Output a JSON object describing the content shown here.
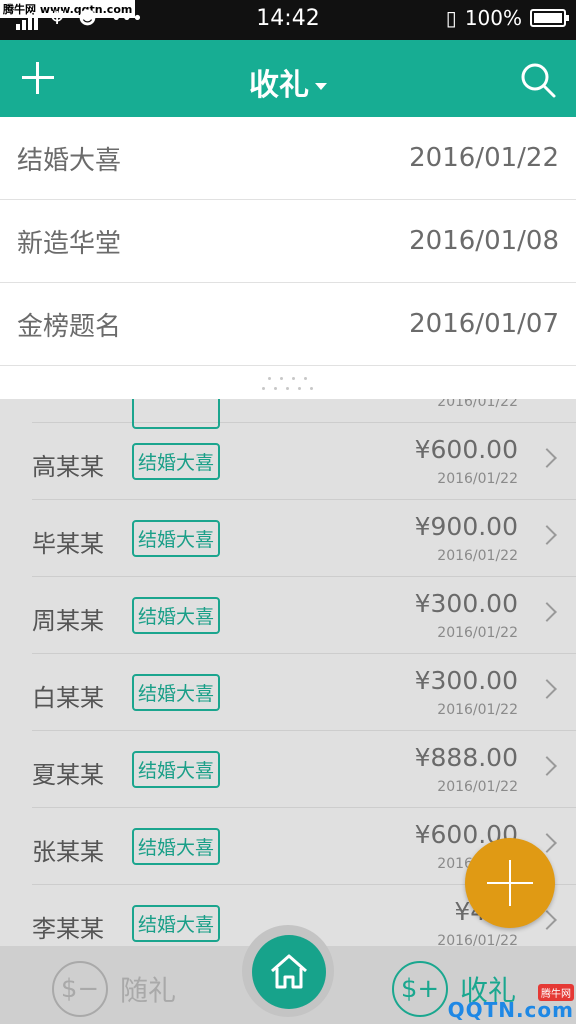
{
  "status_bar": {
    "watermark": "腾牛网 www.qqtn.com",
    "time": "14:42",
    "battery": "100%"
  },
  "appbar": {
    "title": "收礼"
  },
  "dropdown": {
    "items": [
      {
        "label": "结婚大喜",
        "date": "2016/01/22"
      },
      {
        "label": "新造华堂",
        "date": "2016/01/08"
      },
      {
        "label": "金榜题名",
        "date": "2016/01/07"
      }
    ]
  },
  "list": {
    "partial_date": "2016/01/22",
    "rows": [
      {
        "name": "高某某",
        "tag": "结婚大喜",
        "amount": "¥600.00",
        "date": "2016/01/22"
      },
      {
        "name": "毕某某",
        "tag": "结婚大喜",
        "amount": "¥900.00",
        "date": "2016/01/22"
      },
      {
        "name": "周某某",
        "tag": "结婚大喜",
        "amount": "¥300.00",
        "date": "2016/01/22"
      },
      {
        "name": "白某某",
        "tag": "结婚大喜",
        "amount": "¥300.00",
        "date": "2016/01/22"
      },
      {
        "name": "夏某某",
        "tag": "结婚大喜",
        "amount": "¥888.00",
        "date": "2016/01/22"
      },
      {
        "name": "张某某",
        "tag": "结婚大喜",
        "amount": "¥600.00",
        "date": "2016/01/22"
      },
      {
        "name": "李某某",
        "tag": "结婚大喜",
        "amount": "¥480",
        "date": "2016/01/22"
      }
    ]
  },
  "bottom_nav": {
    "give_label": "随礼",
    "receive_label": "收礼",
    "coin_give": "$−",
    "coin_receive": "$+"
  },
  "logo": {
    "badge": "腾牛网",
    "text": "QQTN.com"
  },
  "colors": {
    "accent": "#17ad93",
    "fab": "#e09a14"
  }
}
